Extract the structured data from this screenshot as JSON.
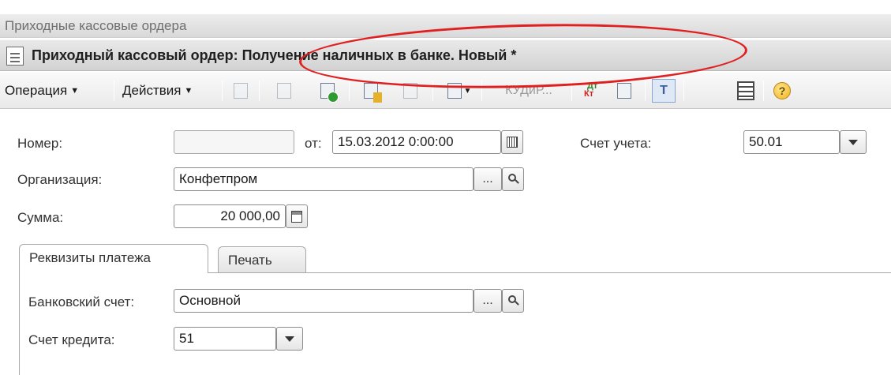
{
  "window": {
    "title": "Приходные кассовые ордера"
  },
  "document": {
    "title": "Приходный кассовый ордер: Получение наличных в банке. Новый *"
  },
  "annotation": {
    "color": "#e02020"
  },
  "toolbar": {
    "operation_menu": "Операция",
    "actions_menu": "Действия",
    "kudir_button": "КУДиР...",
    "dt_label": "Дт",
    "kt_label": "Кт",
    "help_label": "?"
  },
  "form": {
    "number_label": "Номер:",
    "number_value": "",
    "date_prefix": "от:",
    "date_value": "15.03.2012  0:00:00",
    "account_label": "Счет учета:",
    "account_value": "50.01",
    "organization_label": "Организация:",
    "organization_value": "Конфетпром",
    "amount_label": "Сумма:",
    "amount_value": "20 000,00",
    "ellipsis": "..."
  },
  "tabs": [
    {
      "label": "Реквизиты платежа",
      "active": true
    },
    {
      "label": "Печать",
      "active": false
    }
  ],
  "payment": {
    "bank_account_label": "Банковский счет:",
    "bank_account_value": "Основной",
    "credit_account_label": "Счет кредита:",
    "credit_account_value": "51"
  }
}
